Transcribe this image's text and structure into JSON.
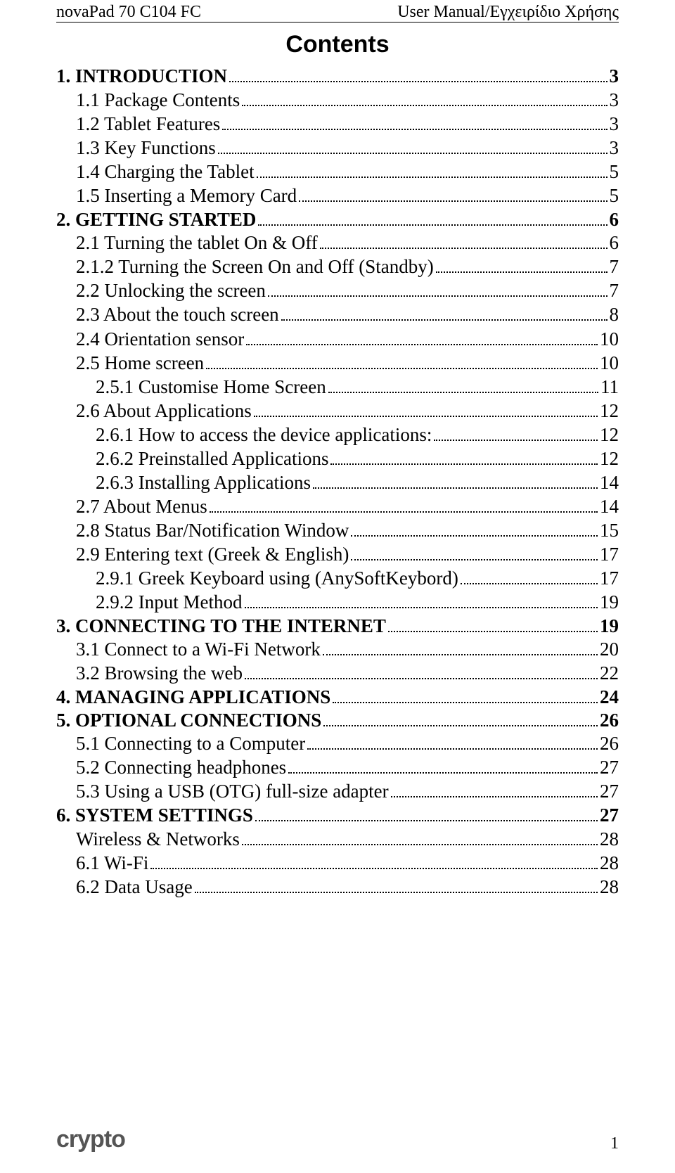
{
  "header": {
    "left": "novaPad 70 C104 FC",
    "right": "User Manual/Εγχειρίδιο Χρήσης"
  },
  "title": "Contents",
  "toc": [
    {
      "label": "1. INTRODUCTION",
      "page": "3",
      "level": 0,
      "bold": true
    },
    {
      "label": "1.1 Package Contents",
      "page": "3",
      "level": 1,
      "bold": false
    },
    {
      "label": "1.2 Tablet Features",
      "page": "3",
      "level": 1,
      "bold": false
    },
    {
      "label": "1.3 Key Functions",
      "page": "3",
      "level": 1,
      "bold": false
    },
    {
      "label": "1.4 Charging the Tablet",
      "page": "5",
      "level": 1,
      "bold": false
    },
    {
      "label": "1.5 Inserting a Memory Card",
      "page": "5",
      "level": 1,
      "bold": false
    },
    {
      "label": "2. GETTING STARTED",
      "page": "6",
      "level": 0,
      "bold": true
    },
    {
      "label": "2.1 Turning the tablet On & Off",
      "page": "6",
      "level": 1,
      "bold": false
    },
    {
      "label": "2.1.2 Turning the Screen On and Off (Standby)",
      "page": "7",
      "level": 1,
      "bold": false
    },
    {
      "label": "2.2 Unlocking the screen",
      "page": "7",
      "level": 1,
      "bold": false
    },
    {
      "label": "2.3 About the touch screen",
      "page": "8",
      "level": 1,
      "bold": false
    },
    {
      "label": "2.4 Orientation sensor",
      "page": "10",
      "level": 1,
      "bold": false
    },
    {
      "label": "2.5 Home screen",
      "page": "10",
      "level": 1,
      "bold": false
    },
    {
      "label": "2.5.1 Customise Home Screen",
      "page": "11",
      "level": 2,
      "bold": false
    },
    {
      "label": "2.6 About Applications",
      "page": "12",
      "level": 1,
      "bold": false
    },
    {
      "label": "2.6.1 How to access the device applications:",
      "page": "12",
      "level": 2,
      "bold": false
    },
    {
      "label": "2.6.2 Preinstalled Applications",
      "page": "12",
      "level": 2,
      "bold": false
    },
    {
      "label": "2.6.3 Installing Applications",
      "page": "14",
      "level": 2,
      "bold": false
    },
    {
      "label": "2.7 About Menus",
      "page": "14",
      "level": 1,
      "bold": false
    },
    {
      "label": "2.8 Status Bar/Notification Window",
      "page": "15",
      "level": 1,
      "bold": false
    },
    {
      "label": "2.9 Entering text (Greek & English)",
      "page": "17",
      "level": 1,
      "bold": false
    },
    {
      "label": "2.9.1 Greek Keyboard using (AnySoftKeybord)",
      "page": "17",
      "level": 2,
      "bold": false
    },
    {
      "label": "2.9.2 Input Method",
      "page": "19",
      "level": 2,
      "bold": false
    },
    {
      "label": "3. CONNECTING TO THE INTERNET",
      "page": "19",
      "level": 0,
      "bold": true
    },
    {
      "label": "3.1 Connect to a Wi-Fi Network",
      "page": "20",
      "level": 1,
      "bold": false
    },
    {
      "label": "3.2 Browsing the web",
      "page": "22",
      "level": 1,
      "bold": false
    },
    {
      "label": "4. MANAGING APPLICATIONS",
      "page": "24",
      "level": 0,
      "bold": true
    },
    {
      "label": "5. OPTIONAL CONNECTIONS",
      "page": "26",
      "level": 0,
      "bold": true
    },
    {
      "label": "5.1 Connecting to a Computer",
      "page": "26",
      "level": 1,
      "bold": false
    },
    {
      "label": "5.2 Connecting headphones",
      "page": "27",
      "level": 1,
      "bold": false
    },
    {
      "label": "5.3 Using a USB (OTG) full-size adapter",
      "page": "27",
      "level": 1,
      "bold": false
    },
    {
      "label": "6. SYSTEM SETTINGS",
      "page": "27",
      "level": 0,
      "bold": true
    },
    {
      "label": "Wireless & Networks",
      "page": "28",
      "level": 1,
      "bold": false
    },
    {
      "label": "6.1 Wi-Fi",
      "page": "28",
      "level": 1,
      "bold": false
    },
    {
      "label": "6.2 Data Usage",
      "page": "28",
      "level": 1,
      "bold": false
    }
  ],
  "footer": {
    "logo": "crypto",
    "page_number": "1"
  }
}
